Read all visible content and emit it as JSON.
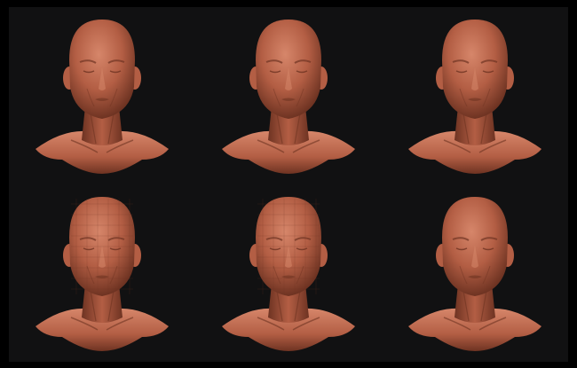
{
  "scene": {
    "background_color": "#111112",
    "frame_color": "#000000",
    "clay_color": "#b35e44",
    "clay_shadow_color": "#6e3322",
    "clay_highlight_color": "#d6866a"
  },
  "models": [
    {
      "id": "head-1",
      "mesh": "smooth",
      "detail": "high"
    },
    {
      "id": "head-2",
      "mesh": "smooth",
      "detail": "medium"
    },
    {
      "id": "head-3",
      "mesh": "smooth",
      "detail": "high"
    },
    {
      "id": "head-4",
      "mesh": "faceted",
      "detail": "low"
    },
    {
      "id": "head-5",
      "mesh": "faceted",
      "detail": "medium"
    },
    {
      "id": "head-6",
      "mesh": "smooth",
      "detail": "medium"
    }
  ]
}
